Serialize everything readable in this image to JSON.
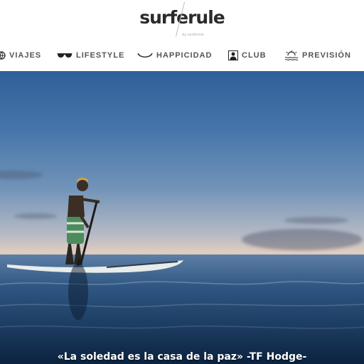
{
  "site": {
    "logo": "surferule",
    "tagline": "by surferule"
  },
  "nav": {
    "items": [
      {
        "label": "VIAJES",
        "icon": "globe-icon"
      },
      {
        "label": "LIFESTYLE",
        "icon": "sunglasses-icon"
      },
      {
        "label": "HAPPICIDAD",
        "icon": "smile-icon"
      },
      {
        "label": "CLUB",
        "icon": "person-card-icon"
      },
      {
        "label": "PREVISIÓN",
        "icon": "sun-wave-icon"
      }
    ]
  },
  "hero": {
    "caption": "«La soledad es la casa de la paz» -TF Hodge-"
  }
}
